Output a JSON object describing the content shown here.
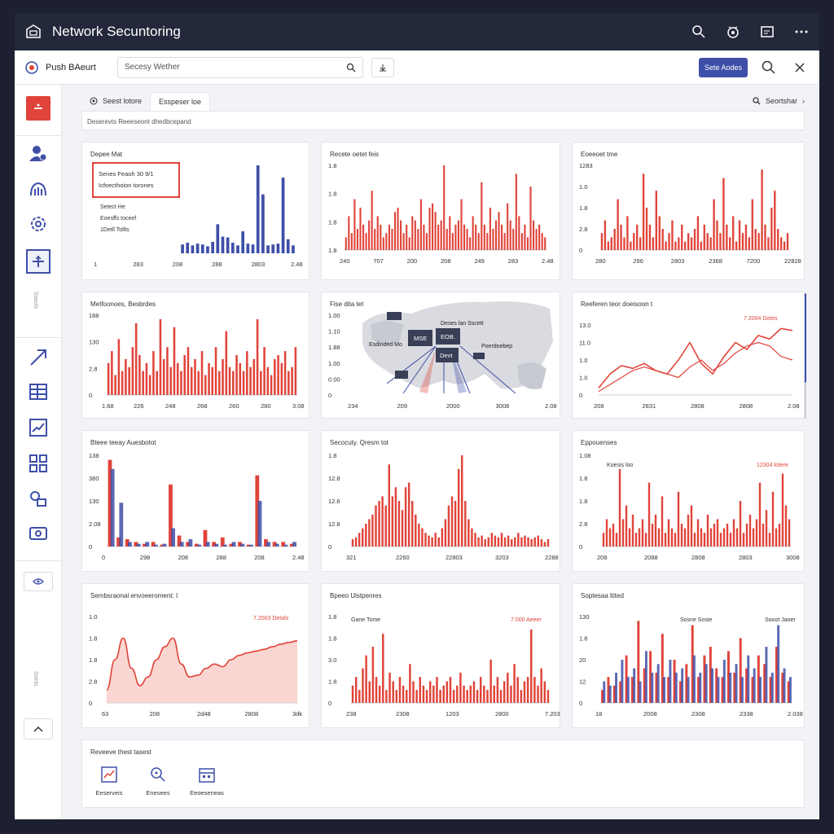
{
  "app": {
    "title": "Network Secuntoring"
  },
  "colors": {
    "accent": "#3e4fa8",
    "red": "#e0443a",
    "dark": "#23283a"
  },
  "toolbar": {
    "brand": "Push BAeurt",
    "search_value": "Secesy Wether",
    "primary_button": "Sete Aodes"
  },
  "tabs": {
    "items": [
      "Seest lotore",
      "Esspeser loe"
    ],
    "right_label": "Seortshar"
  },
  "description": "Deserevts Reeeseont dhedbcepand",
  "sidebar": {
    "vertical_label_1": "Sseols",
    "vertical_label_2": "Solrto"
  },
  "cards": [
    {
      "title": "Depee Mat"
    },
    {
      "title": "Recete oetet feis"
    },
    {
      "title": "Eoeeoet tme"
    },
    {
      "title": "Metfoonoes, Besbrdes"
    },
    {
      "title": "Fise dita tet"
    },
    {
      "title": "Reeferen teor doeisoon t"
    },
    {
      "title": "Bteee teeay Auesbotot"
    },
    {
      "title": "Secocuty. Qresm tot"
    },
    {
      "title": "Eppouenses"
    },
    {
      "title": "Sembsraonal envoeeroment: I"
    },
    {
      "title": "Bpeeo Uistpenres"
    },
    {
      "title": "Soptesaa ltited"
    }
  ],
  "card1": {
    "highlight_line1": "Senes Feaoh 30 9/1",
    "highlight_line2": "Icfoecthoion torones",
    "text1": "Setect He",
    "text2": "Eoesffs toceef",
    "text3": "1Detll Tollts"
  },
  "card5": {
    "box_left": "MSE",
    "box_right": "EOB.",
    "box_bottom": "Devt",
    "label_top": "Deses lan Sscett",
    "label_left": "Esdinded Mo",
    "label_right": "Poerdoebep"
  },
  "annotations": {
    "card6": "7.2004 Dotes",
    "card9_left": "Koesis loo",
    "card9_right": "12304 lotere",
    "card10": "7.2003 Detals",
    "card11_left": "Gane Tome",
    "card11_right": "7.000 Aeeer",
    "card12_left": "Sosne Sosie",
    "card12_right": "Sooot Jaoer"
  },
  "recent": {
    "title": "Reveeve thest tasest",
    "items": [
      "Eeserveis",
      "Enesees",
      "Eeoeseneas"
    ]
  },
  "chart_data": [
    {
      "type": "bar",
      "x": [
        "1",
        "283",
        "208",
        "288",
        "2803",
        "2.48"
      ],
      "yticks": [],
      "values": [
        0.1,
        0.12,
        0.09,
        0.11,
        0.1,
        0.08,
        0.13,
        0.33,
        0.19,
        0.18,
        0.12,
        0.09,
        0.25,
        0.11,
        0.1,
        1.0,
        0.67,
        0.09,
        0.1,
        0.11,
        0.86,
        0.16,
        0.09
      ]
    },
    {
      "type": "bar",
      "x": [
        "240",
        "707",
        "200",
        "208",
        "249",
        "283",
        "2.48"
      ],
      "yticks": [
        "1.8",
        "1.8",
        "1.8",
        "1.8"
      ],
      "values": [
        0.15,
        0.4,
        0.2,
        0.6,
        0.25,
        0.5,
        0.3,
        0.2,
        0.35,
        0.7,
        0.25,
        0.4,
        0.3,
        0.15,
        0.2,
        0.3,
        0.25,
        0.45,
        0.5,
        0.35,
        0.2,
        0.3,
        0.15,
        0.4,
        0.35,
        0.25,
        0.6,
        0.3,
        0.2,
        0.5,
        0.55,
        0.45,
        0.3,
        0.35,
        1.0,
        0.25,
        0.4,
        0.2,
        0.3,
        0.35,
        0.6,
        0.3,
        0.25,
        0.15,
        0.4,
        0.3,
        0.2,
        0.8,
        0.3,
        0.2,
        0.5,
        0.25,
        0.35,
        0.45,
        0.3,
        0.2,
        0.55,
        0.35,
        0.25,
        0.9,
        0.4,
        0.2,
        0.3,
        0.15,
        0.75,
        0.35,
        0.25,
        0.3,
        0.2,
        0.15
      ]
    },
    {
      "type": "bar",
      "x": [
        "280",
        "296",
        "2803",
        "2368",
        "7200",
        "22828"
      ],
      "yticks": [
        "1283",
        "1.0",
        "1.8",
        "2.8",
        "0"
      ],
      "values": [
        0.2,
        0.35,
        0.1,
        0.15,
        0.25,
        0.6,
        0.3,
        0.15,
        0.4,
        0.1,
        0.2,
        0.3,
        0.15,
        0.9,
        0.5,
        0.3,
        0.15,
        0.7,
        0.4,
        0.25,
        0.1,
        0.2,
        0.35,
        0.1,
        0.15,
        0.3,
        0.1,
        0.2,
        0.15,
        0.25,
        0.4,
        0.1,
        0.3,
        0.2,
        0.15,
        0.6,
        0.35,
        0.2,
        0.85,
        0.3,
        0.15,
        0.4,
        0.1,
        0.35,
        0.2,
        0.3,
        0.15,
        0.6,
        0.25,
        0.2,
        0.95,
        0.3,
        0.15,
        0.5,
        0.7,
        0.25,
        0.15,
        0.1,
        0.2
      ]
    },
    {
      "type": "bar",
      "x": [
        "1.68",
        "226",
        "248",
        "268",
        "260",
        "280",
        "3.08"
      ],
      "yticks": [
        "188",
        "130",
        "2.8",
        "0"
      ],
      "values": [
        0.4,
        0.55,
        0.25,
        0.7,
        0.3,
        0.45,
        0.35,
        0.6,
        0.9,
        0.5,
        0.3,
        0.4,
        0.25,
        0.55,
        0.3,
        0.95,
        0.45,
        0.6,
        0.35,
        0.85,
        0.4,
        0.3,
        0.5,
        0.6,
        0.35,
        0.45,
        0.3,
        0.55,
        0.25,
        0.4,
        0.35,
        0.6,
        0.3,
        0.45,
        0.8,
        0.35,
        0.3,
        0.5,
        0.4,
        0.3,
        0.55,
        0.35,
        0.45,
        0.95,
        0.3,
        0.6,
        0.35,
        0.25,
        0.45,
        0.5,
        0.4,
        0.55,
        0.3,
        0.35,
        0.6
      ]
    },
    {
      "type": "map",
      "x": [
        "234",
        "209",
        "2000",
        "3008",
        "2.08"
      ],
      "yticks": [
        "1.00",
        "1.10",
        "1.88",
        "1.00",
        "0.00",
        "0"
      ]
    },
    {
      "type": "line",
      "x": [
        "208",
        "2831",
        "2808",
        "2808",
        "2.08"
      ],
      "yticks": [
        "13.0",
        "11.0",
        "1.0",
        "1.0",
        "0"
      ],
      "series": [
        {
          "values": [
            0.1,
            0.3,
            0.42,
            0.38,
            0.45,
            0.35,
            0.3,
            0.5,
            0.75,
            0.45,
            0.3,
            0.55,
            0.75,
            0.65,
            0.85,
            0.8,
            0.95,
            0.92
          ]
        },
        {
          "values": [
            0.05,
            0.15,
            0.25,
            0.35,
            0.4,
            0.35,
            0.3,
            0.25,
            0.4,
            0.5,
            0.35,
            0.45,
            0.6,
            0.7,
            0.75,
            0.7,
            0.55,
            0.5
          ]
        }
      ]
    },
    {
      "type": "bar",
      "x": [
        "0",
        "298",
        "208",
        "288",
        "208",
        "2.48"
      ],
      "yticks": [
        "138",
        "380",
        "130",
        "2.08",
        "0"
      ],
      "series": [
        {
          "values": [
            0.95,
            0.1,
            0.08,
            0.05,
            0.03,
            0.05,
            0.02,
            0.68,
            0.12,
            0.05,
            0.03,
            0.18,
            0.05,
            0.1,
            0.03,
            0.05,
            0.02,
            0.78,
            0.08,
            0.05,
            0.05,
            0.03
          ]
        },
        {
          "values": [
            0.85,
            0.48,
            0.05,
            0.03,
            0.05,
            0.02,
            0.03,
            0.2,
            0.05,
            0.08,
            0.02,
            0.05,
            0.03,
            0.02,
            0.05,
            0.03,
            0.02,
            0.5,
            0.05,
            0.03,
            0.02,
            0.05
          ]
        }
      ]
    },
    {
      "type": "bar",
      "x": [
        "321",
        "2260",
        "22803",
        "3203",
        "2288"
      ],
      "yticks": [
        "1.8",
        "12.8",
        "12.6",
        "12.8",
        "0"
      ],
      "values": [
        0.08,
        0.1,
        0.15,
        0.2,
        0.25,
        0.3,
        0.35,
        0.45,
        0.5,
        0.55,
        0.45,
        0.9,
        0.55,
        0.65,
        0.5,
        0.4,
        0.65,
        0.7,
        0.5,
        0.35,
        0.25,
        0.2,
        0.15,
        0.12,
        0.1,
        0.15,
        0.1,
        0.2,
        0.3,
        0.45,
        0.55,
        0.5,
        0.85,
        1.0,
        0.5,
        0.3,
        0.2,
        0.15,
        0.1,
        0.12,
        0.08,
        0.1,
        0.15,
        0.12,
        0.1,
        0.15,
        0.1,
        0.12,
        0.08,
        0.1,
        0.15,
        0.1,
        0.12,
        0.1,
        0.08,
        0.1,
        0.12,
        0.08,
        0.05,
        0.08
      ]
    },
    {
      "type": "bar",
      "x": [
        "208",
        "2088",
        "2808",
        "2803",
        "3008"
      ],
      "yticks": [
        "1.08",
        "1.8",
        "1.8",
        "2.8",
        "0"
      ],
      "values": [
        0.15,
        0.3,
        0.2,
        0.25,
        0.15,
        0.85,
        0.3,
        0.45,
        0.2,
        0.35,
        0.15,
        0.2,
        0.3,
        0.15,
        0.7,
        0.25,
        0.35,
        0.2,
        0.55,
        0.15,
        0.3,
        0.2,
        0.15,
        0.6,
        0.25,
        0.2,
        0.35,
        0.45,
        0.15,
        0.3,
        0.2,
        0.15,
        0.35,
        0.2,
        0.25,
        0.3,
        0.15,
        0.2,
        0.25,
        0.15,
        0.3,
        0.2,
        0.5,
        0.15,
        0.25,
        0.35,
        0.2,
        0.3,
        0.7,
        0.25,
        0.4,
        0.15,
        0.6,
        0.2,
        0.25,
        0.8,
        0.45,
        0.3
      ]
    },
    {
      "type": "area",
      "x": [
        "63",
        "208",
        "2d48",
        "2808",
        "3dk"
      ],
      "yticks": [
        "1.0",
        "1.8",
        "1.8",
        "2.8",
        "0"
      ],
      "values": [
        0.15,
        0.5,
        0.75,
        0.4,
        0.2,
        0.3,
        0.5,
        0.65,
        0.75,
        0.45,
        0.3,
        0.32,
        0.4,
        0.45,
        0.42,
        0.5,
        0.55,
        0.58,
        0.6,
        0.62,
        0.65,
        0.68,
        0.7,
        0.72
      ]
    },
    {
      "type": "bar",
      "x": [
        "238",
        "2308",
        "1203",
        "2800",
        "7.203"
      ],
      "yticks": [
        "1.8",
        "1.8",
        "3.0",
        "1.8",
        "0"
      ],
      "values": [
        0.2,
        0.3,
        0.15,
        0.4,
        0.55,
        0.25,
        0.65,
        0.3,
        0.2,
        0.8,
        0.15,
        0.35,
        0.25,
        0.15,
        0.3,
        0.2,
        0.15,
        0.45,
        0.25,
        0.15,
        0.3,
        0.2,
        0.15,
        0.25,
        0.2,
        0.3,
        0.15,
        0.2,
        0.25,
        0.3,
        0.15,
        0.2,
        0.35,
        0.2,
        0.15,
        0.2,
        0.25,
        0.15,
        0.3,
        0.2,
        0.15,
        0.5,
        0.2,
        0.3,
        0.15,
        0.25,
        0.35,
        0.2,
        0.45,
        0.3,
        0.15,
        0.25,
        0.3,
        0.85,
        0.3,
        0.2,
        0.4,
        0.25,
        0.15
      ]
    },
    {
      "type": "bar",
      "x": [
        "18",
        "2008",
        "2308",
        "2338",
        "2.038"
      ],
      "yticks": [
        "130",
        "1.8",
        "20",
        "12",
        "0"
      ],
      "series": [
        {
          "values": [
            0.15,
            0.3,
            0.2,
            0.25,
            0.55,
            0.3,
            0.95,
            0.4,
            0.6,
            0.35,
            0.8,
            0.3,
            0.5,
            0.25,
            0.45,
            0.9,
            0.3,
            0.55,
            0.65,
            0.4,
            0.3,
            0.6,
            0.35,
            0.75,
            0.4,
            0.3,
            0.55,
            0.45,
            0.3,
            0.65,
            0.35,
            0.25
          ]
        },
        {
          "values": [
            0.25,
            0.2,
            0.35,
            0.5,
            0.3,
            0.4,
            0.25,
            0.6,
            0.35,
            0.45,
            0.3,
            0.5,
            0.35,
            0.4,
            0.3,
            0.55,
            0.35,
            0.45,
            0.4,
            0.3,
            0.5,
            0.35,
            0.45,
            0.3,
            0.55,
            0.4,
            0.3,
            0.65,
            0.35,
            0.9,
            0.4,
            0.3
          ]
        }
      ]
    }
  ]
}
